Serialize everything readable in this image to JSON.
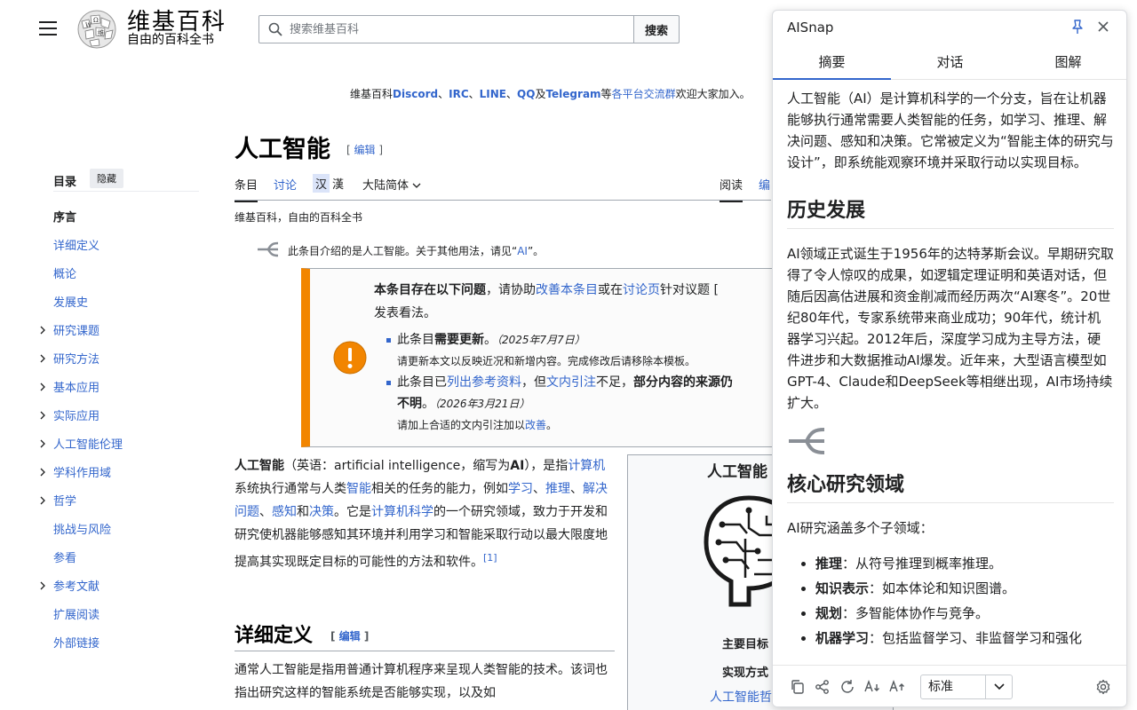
{
  "header": {
    "logo_title": "维基百科",
    "logo_subtitle": "自由的百科全书",
    "search_placeholder": "搜索维基百科",
    "search_button": "搜索"
  },
  "notice": {
    "prefix": "维基百科",
    "links": [
      "Discord",
      "IRC",
      "LINE",
      "QQ",
      "Telegram"
    ],
    "sep1": "、",
    "sep2": "、",
    "sep3": "、",
    "sep4": "及",
    "mid": "等",
    "group_link": "各平台交流群",
    "suffix": "欢迎大家加入。"
  },
  "toc": {
    "title": "目录",
    "hide": "隐藏",
    "items": [
      {
        "label": "序言",
        "expandable": false
      },
      {
        "label": "详细定义",
        "expandable": false
      },
      {
        "label": "概论",
        "expandable": false
      },
      {
        "label": "发展史",
        "expandable": false
      },
      {
        "label": "研究课题",
        "expandable": true
      },
      {
        "label": "研究方法",
        "expandable": true
      },
      {
        "label": "基本应用",
        "expandable": true
      },
      {
        "label": "实际应用",
        "expandable": true
      },
      {
        "label": "人工智能伦理",
        "expandable": true
      },
      {
        "label": "学科作用域",
        "expandable": true
      },
      {
        "label": "哲学",
        "expandable": true
      },
      {
        "label": "挑战与风险",
        "expandable": false
      },
      {
        "label": "参看",
        "expandable": false
      },
      {
        "label": "参考文献",
        "expandable": true
      },
      {
        "label": "扩展阅读",
        "expandable": false
      },
      {
        "label": "外部链接",
        "expandable": false
      }
    ]
  },
  "article": {
    "title": "人工智能",
    "edit_open": "[ ",
    "edit": "编辑",
    "edit_close": " ]",
    "tabs": {
      "article": "条目",
      "talk": "讨论",
      "read": "阅读",
      "edit_partial": "编"
    },
    "hanzi_simplified": "汉",
    "hanzi_traditional": "漢",
    "variant": "大陆简体",
    "from": "维基百科，自由的百科全书",
    "hatnote_pre": "此条目介绍的是人工智能。关于其他用法，请见“",
    "hatnote_link": "AI",
    "hatnote_post": "”。",
    "ambox": {
      "line1_a": "本条目存在以下问题",
      "line1_b": "，请协助",
      "line1_link1": "改善本条目",
      "line1_c": "或在",
      "line1_link2": "讨论页",
      "line1_d": "针对议题",
      "line1_e": " [",
      "line1_f": "发表看法。",
      "item1_a": "此条目",
      "item1_b": "需要更新",
      "item1_c": "。",
      "item1_date": "（2025年7月7日）",
      "item1_note": "请更新本文以反映近况和新增内容。完成修改后请移除本模板。",
      "item2_a": "此条目已",
      "item2_link1": "列出参考资料",
      "item2_b": "，但",
      "item2_link2": "文内引注",
      "item2_c": "不足，",
      "item2_d": "部分内容的来源仍",
      "item2_e": "不明",
      "item2_f": "。",
      "item2_date": "（2026年3月21日）",
      "item2_note_a": "请加上合适的文内引注加以",
      "item2_note_link": "改善",
      "item2_note_b": "。"
    },
    "p1": {
      "a": "人工智能",
      "b": "（英语：artificial intelligence，缩写为",
      "c": "AI",
      "d": "），是指",
      "l1": "计算机",
      "e": "系统执行通常与人类",
      "l2": "智能",
      "f": "相关的任务的能力，例如",
      "l3": "学习",
      "g": "、",
      "l4": "推理",
      "h": "、",
      "l5": "解决问题",
      "i": "、",
      "l6": "感知",
      "j": "和",
      "l7": "决策",
      "k": "。它是",
      "l8": "计算机科学",
      "m": "的一个研究领域，致力于开发和研究使机器能够感知其环境并利用学习和智能采取行动以最大限度地提高其实现既定目标的可能性的方法和软件。",
      "ref": "[1]"
    },
    "infobox": {
      "title": "人工智能",
      "row1": "主要目标",
      "row2": "实现方式",
      "row3": "人工智能哲"
    },
    "h2": "详细定义",
    "p2": "通常人工智能是指用普通计算机程序来呈现人类智能的技术。该词也指出研究这样的智能系统是否能够实现，以及如"
  },
  "panel": {
    "title": "AISnap",
    "tabs": [
      "摘要",
      "对话",
      "图解"
    ],
    "intro": "人工智能（AI）是计算机科学的一个分支，旨在让机器能够执行通常需要人类智能的任务，如学习、推理、解决问题、感知和决策。它常被定义为“智能主体的研究与设计”，即系统能观察环境并采取行动以实现目标。",
    "h_history": "历史发展",
    "history": "AI领域正式诞生于1956年的达特茅斯会议。早期研究取得了令人惊叹的成果，如逻辑定理证明和英语对话，但随后因高估进展和资金削减而经历两次“AI寒冬”。20世纪80年代，专家系统带来商业成功；90年代，统计机器学习兴起。2012年后，深度学习成为主导方法，硬件进步和大数据推动AI爆发。近年来，大型语言模型如GPT-4、Claude和DeepSeek等相继出现，AI市场持续扩大。",
    "h_core": "核心研究领域",
    "core_intro": "AI研究涵盖多个子领域：",
    "core_items": [
      {
        "term": "推理",
        "desc": "：从符号推理到概率推理。"
      },
      {
        "term": "知识表示",
        "desc": "：如本体论和知识图谱。"
      },
      {
        "term": "规划",
        "desc": "：多智能体协作与竞争。"
      },
      {
        "term": "机器学习",
        "desc": "：包括监督学习、非监督学习和强化"
      }
    ],
    "footer_select": "标准"
  },
  "colors": {
    "link": "#3366cc",
    "ambox_border": "#f28500",
    "warn": "#f28500"
  }
}
